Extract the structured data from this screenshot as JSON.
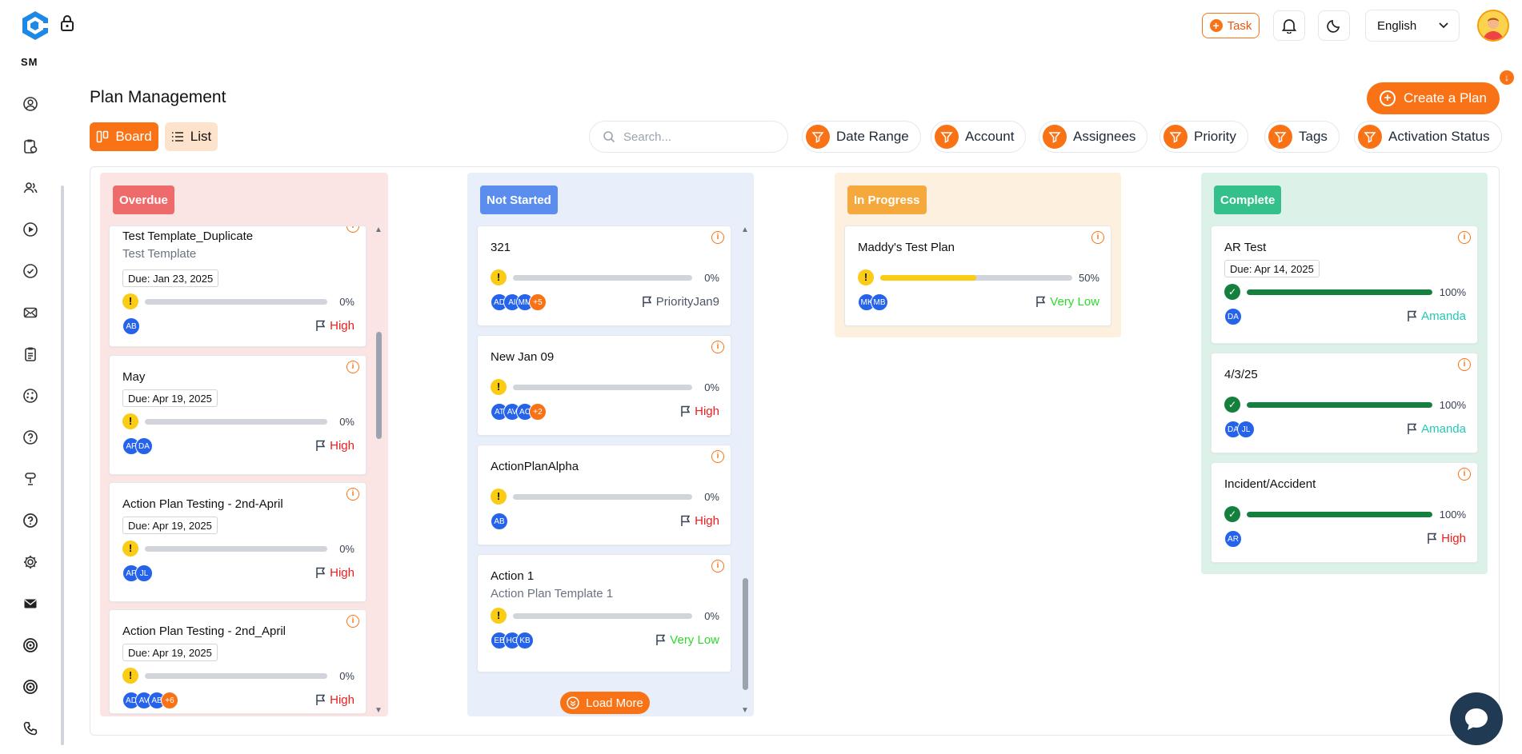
{
  "sidebar": {
    "brand_short": "SM",
    "nav_icons": [
      "user-circle-icon",
      "clipboard-user-icon",
      "users-icon",
      "play-icon",
      "check-circle-icon",
      "mail-icon",
      "clipboard-list-icon",
      "palette-icon",
      "help-circle-icon",
      "trophy-icon",
      "question-icon",
      "settings-icon",
      "envelope-icon",
      "target-icon",
      "radar-icon",
      "phone-icon"
    ]
  },
  "topbar": {
    "task_label": "Task",
    "language": "English"
  },
  "header": {
    "title": "Plan Management",
    "create_label": "Create a Plan",
    "board_label": "Board",
    "list_label": "List",
    "search_placeholder": "Search...",
    "filters": [
      "Date Range",
      "Account",
      "Assignees",
      "Priority",
      "Tags",
      "Activation Status"
    ]
  },
  "colors": {
    "accent": "#f97316",
    "overdue": "#ef6a6a",
    "not_started": "#5b8def",
    "in_progress": "#f5a93c",
    "complete": "#34c08a",
    "high": "#ef1c1c",
    "very_low": "#2fd82f",
    "amanda": "#22c9b6"
  },
  "columns": {
    "overdue": {
      "label": "Overdue",
      "cards": [
        {
          "title": "Test Template_Duplicate",
          "sub": "Test Template",
          "due": "Due: Jan 23, 2025",
          "pct": "0%",
          "progress": 0,
          "avatars": [
            "AB"
          ],
          "priority": "High"
        },
        {
          "title": "May",
          "due": "Due: Apr 19, 2025",
          "pct": "0%",
          "progress": 0,
          "avatars": [
            "AP",
            "DA"
          ],
          "priority": "High"
        },
        {
          "title": "Action Plan Testing - 2nd-April",
          "due": "Due: Apr 19, 2025",
          "pct": "0%",
          "progress": 0,
          "avatars": [
            "AP",
            "JL"
          ],
          "priority": "High"
        },
        {
          "title": "Action Plan Testing - 2nd_April",
          "due": "Due: Apr 19, 2025",
          "pct": "0%",
          "progress": 0,
          "avatars": [
            "AD",
            "AV",
            "AB"
          ],
          "more": "+6",
          "priority": "High"
        }
      ]
    },
    "not_started": {
      "label": "Not Started",
      "load_more": "Load More",
      "cards": [
        {
          "title": "321",
          "pct": "0%",
          "progress": 0,
          "avatars": [
            "AD",
            "AI",
            "MM"
          ],
          "more": "+5",
          "priority": "PriorityJan9"
        },
        {
          "title": "New Jan 09",
          "pct": "0%",
          "progress": 0,
          "avatars": [
            "AT",
            "AV",
            "AC"
          ],
          "more": "+2",
          "priority": "High"
        },
        {
          "title": "ActionPlanAlpha",
          "pct": "0%",
          "progress": 0,
          "avatars": [
            "AB"
          ],
          "priority": "High"
        },
        {
          "title": "Action 1",
          "sub": "Action Plan Template 1",
          "pct": "0%",
          "progress": 0,
          "avatars": [
            "EB",
            "HG",
            "KB"
          ],
          "priority": "Very Low"
        }
      ]
    },
    "in_progress": {
      "label": "In Progress",
      "cards": [
        {
          "title": "Maddy's Test Plan",
          "pct": "50%",
          "progress": 50,
          "avatars": [
            "MK",
            "MB"
          ],
          "priority": "Very Low"
        }
      ]
    },
    "complete": {
      "label": "Complete",
      "cards": [
        {
          "title": "AR Test",
          "due": "Due: Apr 14, 2025",
          "pct": "100%",
          "progress": 100,
          "avatars": [
            "DA"
          ],
          "priority": "Amanda"
        },
        {
          "title": "4/3/25",
          "pct": "100%",
          "progress": 100,
          "avatars": [
            "DA",
            "JL"
          ],
          "priority": "Amanda"
        },
        {
          "title": "Incident/Accident",
          "pct": "100%",
          "progress": 100,
          "avatars": [
            "AR"
          ],
          "priority": "High"
        }
      ]
    }
  }
}
